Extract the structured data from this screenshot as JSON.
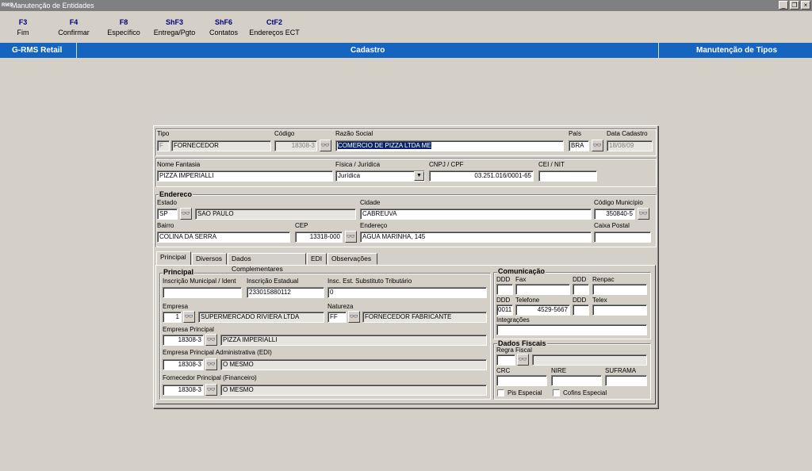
{
  "window": {
    "title": "Manutenção de Entidades",
    "icon_text": "RMS",
    "minimize": "_",
    "maximize": "❐",
    "close": "×"
  },
  "toolbar": {
    "keys": [
      {
        "key": "F3",
        "label": "Fim"
      },
      {
        "key": "F4",
        "label": "Confirmar"
      },
      {
        "key": "F8",
        "label": "Específico"
      },
      {
        "key": "ShF3",
        "label": "Entrega/Pgto"
      },
      {
        "key": "ShF6",
        "label": "Contatos"
      },
      {
        "key": "CtF2",
        "label": "Endereços ECT"
      }
    ]
  },
  "bar": {
    "left": "G-RMS Retail",
    "center": "Cadastro",
    "right": "Manutenção de Tipos"
  },
  "header": {
    "tipo_label": "Tipo",
    "tipo_code": "F",
    "tipo_desc": "FORNECEDOR",
    "codigo_label": "Código",
    "codigo": "18308-3",
    "razao_label": "Razão Social",
    "razao": "COMERCIO DE PIZZA LTDA ME",
    "pais_label": "País",
    "pais": "BRA",
    "data_label": "Data Cadastro",
    "data": "18/08/09",
    "fantasia_label": "Nome Fantasia",
    "fantasia": "PIZZA IMPERIALLI",
    "fisjur_label": "Física / Jurídica",
    "fisjur": "Jurídica",
    "cnpj_label": "CNPJ / CPF",
    "cnpj": "03.251.016/0001-65",
    "cei_label": "CEI / NIT",
    "cei": ""
  },
  "endereco": {
    "title": "Endereco",
    "estado_label": "Estado",
    "estado": "SP",
    "estado_nome": "SAO PAULO",
    "cidade_label": "Cidade",
    "cidade": "CABREUVA",
    "municipio_label": "Código Município",
    "municipio": "350840-5",
    "bairro_label": "Bairro",
    "bairro": "COLINA DA SERRA",
    "cep_label": "CEP",
    "cep": "13318-000",
    "endereco_label": "Endereço",
    "endereco": "AGUA MARINHA, 145",
    "caixa_label": "Caixa Postal",
    "caixa": ""
  },
  "tabs": [
    "Principal",
    "Diversos",
    "Dados Complementares",
    "EDI",
    "Observações"
  ],
  "principal": {
    "title": "Principal",
    "insc_mun_label": "Inscrição Municipal / Ident",
    "insc_mun": "",
    "insc_est_label": "Inscrição Estadual",
    "insc_est": "233015880112",
    "insc_sub_label": "Insc. Est. Substituto Tributário",
    "insc_sub": "0",
    "empresa_label": "Empresa",
    "empresa_code": "1",
    "empresa_desc": "SUPERMERCADO RIVIERA LTDA",
    "natureza_label": "Natureza",
    "natureza_code": "FF",
    "natureza_desc": "FORNECEDOR FABRICANTE",
    "emp_principal_label": "Empresa Principal",
    "emp_principal_code": "18308-3",
    "emp_principal_desc": "PIZZA IMPERIALLI",
    "emp_adm_label": "Empresa Principal Administrativa (EDI)",
    "emp_adm_code": "18308-3",
    "emp_adm_desc": "O MESMO",
    "forn_label": "Fornecedor Principal (Financeiro)",
    "forn_code": "18308-3",
    "forn_desc": "O MESMO"
  },
  "comunicacao": {
    "title": "Comunicação",
    "ddd1_label": "DDD",
    "fax_label": "Fax",
    "ddd2_label": "DDD",
    "renpac_label": "Renpac",
    "ddd3_label": "DDD",
    "telefone_label": "Telefone",
    "ddd4_label": "DDD",
    "telex_label": "Telex",
    "ddd_tel": "0011",
    "telefone": "4529-5667",
    "integracoes_label": "Integrações"
  },
  "fiscais": {
    "title": "Dados Fiscais",
    "regra_label": "Regra Fiscal",
    "crc_label": "CRC",
    "nire_label": "NIRE",
    "suframa_label": "SUFRAMA",
    "pis_label": "Pis Especial",
    "cofins_label": "Cofins Especial"
  },
  "icons": {
    "binoculars": "👓",
    "dropdown": "▼"
  }
}
